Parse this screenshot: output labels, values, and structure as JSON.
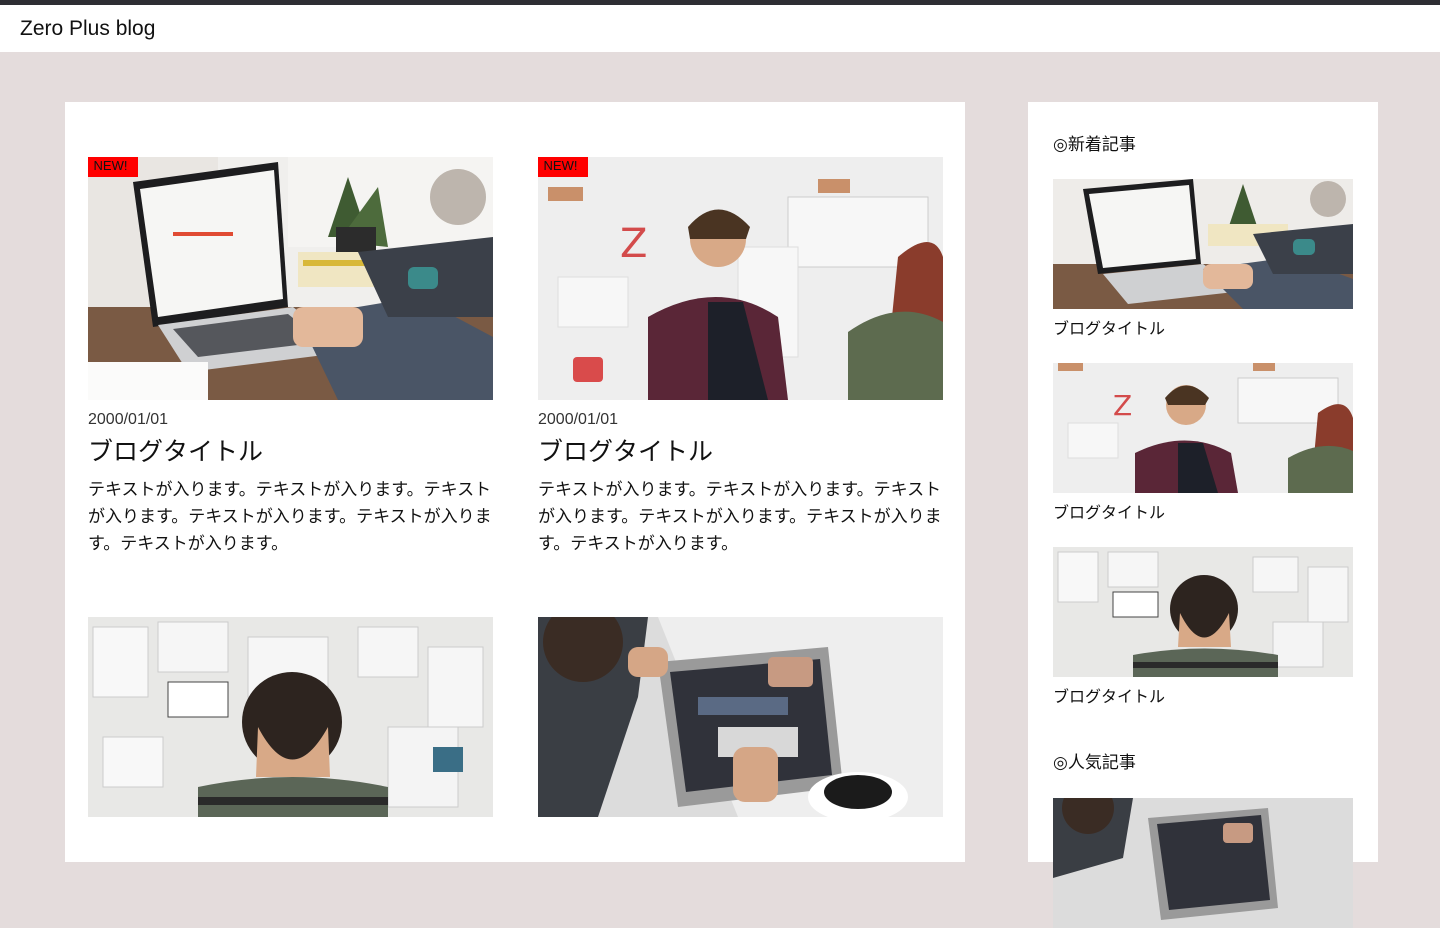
{
  "header": {
    "site_title": "Zero Plus blog"
  },
  "posts": [
    {
      "badge": "NEW!",
      "date": "2000/01/01",
      "title": "ブログタイトル",
      "excerpt": "テキストが入ります。テキストが入ります。テキストが入ります。テキストが入ります。テキストが入ります。テキストが入ります。"
    },
    {
      "badge": "NEW!",
      "date": "2000/01/01",
      "title": "ブログタイトル",
      "excerpt": "テキストが入ります。テキストが入ります。テキストが入ります。テキストが入ります。テキストが入ります。テキストが入ります。"
    },
    {
      "badge": "",
      "date": "",
      "title": "",
      "excerpt": ""
    },
    {
      "badge": "",
      "date": "",
      "title": "",
      "excerpt": ""
    }
  ],
  "sidebar": {
    "recent_heading": "◎新着記事",
    "recent": [
      {
        "title": "ブログタイトル"
      },
      {
        "title": "ブログタイトル"
      },
      {
        "title": "ブログタイトル"
      }
    ],
    "popular_heading": "◎人気記事"
  },
  "colors": {
    "page_bg": "#e4dcdc",
    "badge_bg": "#ff0000",
    "panel_bg": "#ffffff"
  }
}
